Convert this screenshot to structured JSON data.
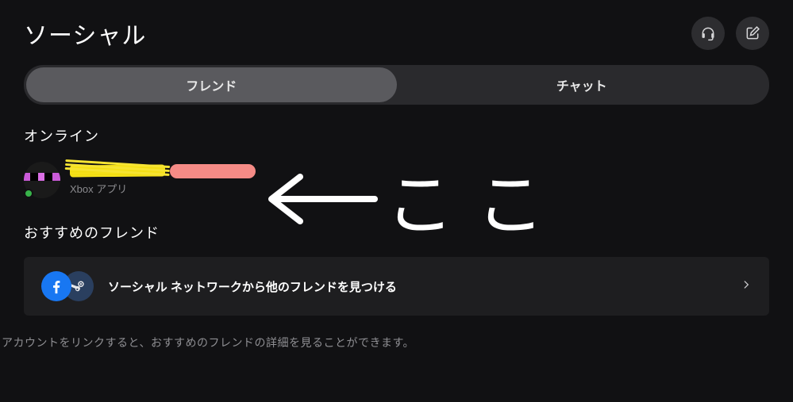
{
  "header": {
    "title": "ソーシャル"
  },
  "tabs": {
    "friends": "フレンド",
    "chat": "チャット"
  },
  "online": {
    "heading": "オンライン",
    "friend_status": "Xbox アプリ"
  },
  "annotation": {
    "label": "ここ"
  },
  "suggested": {
    "heading": "おすすめのフレンド",
    "card_text": "ソーシャル ネットワークから他のフレンドを見つける"
  },
  "footer": {
    "text": "アカウントをリンクすると、おすすめのフレンドの詳細を見ることができます。"
  }
}
